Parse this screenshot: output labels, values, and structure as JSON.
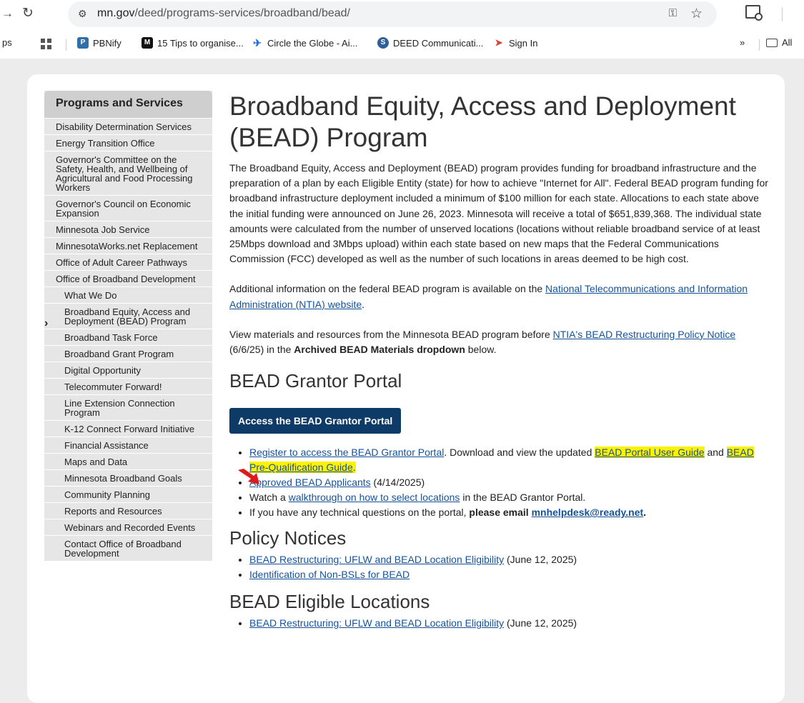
{
  "browser": {
    "url_host": "mn.gov",
    "url_path": "/deed/programs-services/broadband/bead/",
    "bookmarks": [
      {
        "label": "PBNify",
        "color": "#2f6fa8"
      },
      {
        "label": "15 Tips to organise...",
        "color": "#111111"
      },
      {
        "label": "Circle the Globe - Ai...",
        "color": "#1a73e8"
      },
      {
        "label": "DEED Communicati...",
        "color": "#2f5f97"
      },
      {
        "label": "Sign In",
        "color": "#d6433a"
      }
    ],
    "bookmark_overflow": "»",
    "all_bookmarks_label": "All",
    "left_fragment": "ps"
  },
  "sidebar": {
    "header": "Programs and Services",
    "items": [
      {
        "label": "Disability Determination Services",
        "level": 0
      },
      {
        "label": "Energy Transition Office",
        "level": 0
      },
      {
        "label": "Governor's Committee on the Safety, Health, and Wellbeing of Agricultural and Food Processing Workers",
        "level": 0
      },
      {
        "label": "Governor's Council on Economic Expansion",
        "level": 0
      },
      {
        "label": "Minnesota Job Service",
        "level": 0
      },
      {
        "label": "MinnesotaWorks.net Replacement",
        "level": 0
      },
      {
        "label": "Office of Adult Career Pathways",
        "level": 0
      },
      {
        "label": "Office of Broadband Development",
        "level": 0
      },
      {
        "label": "What We Do",
        "level": 1
      },
      {
        "label": "Broadband Equity, Access and Deployment (BEAD) Program",
        "level": 1,
        "active": true
      },
      {
        "label": "Broadband Task Force",
        "level": 1
      },
      {
        "label": "Broadband Grant Program",
        "level": 1
      },
      {
        "label": "Digital Opportunity",
        "level": 1
      },
      {
        "label": "Telecommuter Forward!",
        "level": 1
      },
      {
        "label": "Line Extension Connection Program",
        "level": 1
      },
      {
        "label": "K-12 Connect Forward Initiative",
        "level": 1
      },
      {
        "label": "Financial Assistance",
        "level": 1
      },
      {
        "label": "Maps and Data",
        "level": 1
      },
      {
        "label": "Minnesota Broadband Goals",
        "level": 1
      },
      {
        "label": "Community Planning",
        "level": 1
      },
      {
        "label": "Reports and Resources",
        "level": 1
      },
      {
        "label": "Webinars and Recorded Events",
        "level": 1
      },
      {
        "label": "Contact Office of Broadband Development",
        "level": 1
      }
    ]
  },
  "main": {
    "title": "Broadband Equity, Access and Deployment (BEAD) Program",
    "intro": "The Broadband Equity, Access and Deployment (BEAD) program provides funding for broadband infrastructure and the preparation of a plan by each Eligible Entity (state) for how to achieve \"Internet for All\". Federal BEAD program funding for broadband infrastructure deployment included a minimum of $100 million for each state. Allocations to each state above the initial funding were announced on June 26, 2023. Minnesota will receive a total of $651,839,368. The individual state amounts were calculated from the number of unserved locations (locations without reliable broadband service of at least 25Mbps download and 3Mbps upload) within each state based on new maps that the Federal Communications Commission (FCC) developed as well as the number of such locations in areas deemed to be high cost.",
    "additional_prefix": "Additional information on the federal BEAD program is available on the ",
    "additional_link": "National Telecommunications and Information Administration (NTIA) website",
    "additional_suffix": ".",
    "view_prefix": "View materials and resources from the Minnesota BEAD program before ",
    "view_link": "NTIA's BEAD Restructuring Policy Notice",
    "view_middle": " (6/6/25) in the ",
    "view_bold": "Archived BEAD Materials dropdown",
    "view_suffix": " below.",
    "portal_heading": "BEAD Grantor Portal",
    "portal_button": "Access the BEAD Grantor Portal",
    "portal_list": {
      "item1_link": "Register to access the BEAD Grantor Portal",
      "item1_mid": ". Download and view the updated ",
      "item1_link2": "BEAD Portal User Guide",
      "item1_and": " and ",
      "item1_link3": "BEAD Pre-Qualification Guide",
      "item1_end": ".",
      "item2_link": "Approved BEAD Applicants",
      "item2_suffix": " (4/14/2025)",
      "item3_prefix": "Watch a ",
      "item3_link": "walkthrough on how to select locations",
      "item3_suffix": " in the BEAD Grantor Portal.",
      "item4_prefix": "If you have any technical questions on the portal, ",
      "item4_bold": "please email ",
      "item4_link": "mnhelpdesk@ready.net",
      "item4_suffix": "."
    },
    "policy_heading": "Policy Notices",
    "policy_items": [
      {
        "link": "BEAD Restructuring: UFLW and BEAD Location Eligibility",
        "suffix": " (June 12, 2025)"
      },
      {
        "link": "Identification of Non-BSLs for BEAD",
        "suffix": ""
      }
    ],
    "eligible_heading": "BEAD Eligible Locations",
    "eligible_items": [
      {
        "link": "BEAD Restructuring: UFLW and BEAD Location Eligibility",
        "suffix": " (June 12, 2025)"
      }
    ]
  }
}
